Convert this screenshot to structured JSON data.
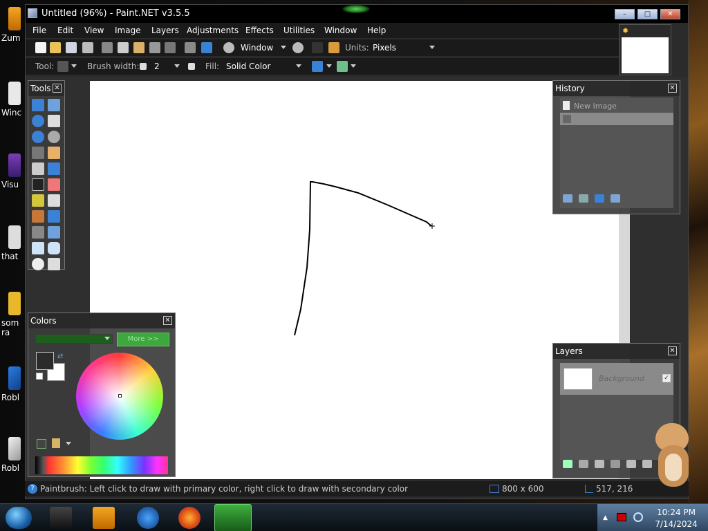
{
  "desktop": {
    "icons": [
      {
        "label": "Zum"
      },
      {
        "label": "Winc"
      },
      {
        "label": "Visu"
      },
      {
        "label": "that"
      },
      {
        "label": "som ra"
      },
      {
        "label": "Robl"
      },
      {
        "label": "Robl"
      }
    ]
  },
  "window": {
    "title": "Untitled (96%) - Paint.NET v3.5.5"
  },
  "menu": [
    "File",
    "Edit",
    "View",
    "Image",
    "Layers",
    "Adjustments",
    "Effects",
    "Utilities",
    "Window",
    "Help"
  ],
  "toolbar1": {
    "zoom_value": "Window",
    "units_label": "Units:",
    "units_value": "Pixels"
  },
  "toolbar2": {
    "tool_label": "Tool:",
    "brush_label": "Brush width:",
    "brush_value": "2",
    "fill_label": "Fill:",
    "fill_value": "Solid Color"
  },
  "panels": {
    "tools_title": "Tools",
    "colors_title": "Colors",
    "colors_more": "More >>",
    "history_title": "History",
    "history_items": [
      "New Image",
      ""
    ],
    "layers_title": "Layers",
    "layer_name": "Background"
  },
  "status": {
    "hint": "Paintbrush: Left click to draw with primary color, right click to draw with secondary color",
    "size": "800 x 600",
    "cursor": "517, 216"
  },
  "taskbar": {
    "time": "10:24 PM",
    "date": "7/14/2024"
  },
  "colors": {
    "stroke": "#000000",
    "primary": "#2b2b2b",
    "secondary": "#ffffff"
  }
}
